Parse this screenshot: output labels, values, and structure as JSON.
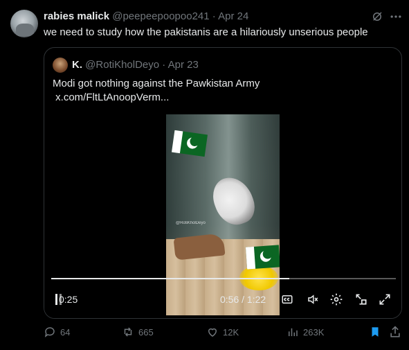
{
  "tweet": {
    "author_name": "rabies malick",
    "author_handle": "@peepeepoopoo241",
    "separator": "·",
    "date": "Apr 24",
    "text": "we need to  study how the pakistanis are a hilariously unserious people"
  },
  "quote": {
    "author_name": "K.",
    "author_handle": "@RotiKholDeyo",
    "separator": "·",
    "date": "Apr 23",
    "text_line1": "Modi got nothing against the Pawkistan Army",
    "text_line2": " x.com/FltLtAnoopVerm..."
  },
  "video": {
    "watermark": "@RotiKholDeyo",
    "elapsed_left": "0:25",
    "time_right": "0:56 / 1:22",
    "progress": 0.69
  },
  "actions": {
    "replies": "64",
    "reposts": "665",
    "likes": "12K",
    "views": "263K"
  },
  "colors": {
    "background": "#000000",
    "text_primary": "#e7e9ea",
    "text_secondary": "#71767b",
    "border": "#2f3336",
    "bookmark_active": "#1d9bf0"
  },
  "icons": [
    "grok-icon",
    "more-icon",
    "play-icon",
    "cc-icon",
    "mute-icon",
    "settings-icon",
    "popout-icon",
    "fullscreen-icon",
    "reply-icon",
    "retweet-icon",
    "like-icon",
    "views-icon",
    "bookmark-icon",
    "share-icon"
  ]
}
